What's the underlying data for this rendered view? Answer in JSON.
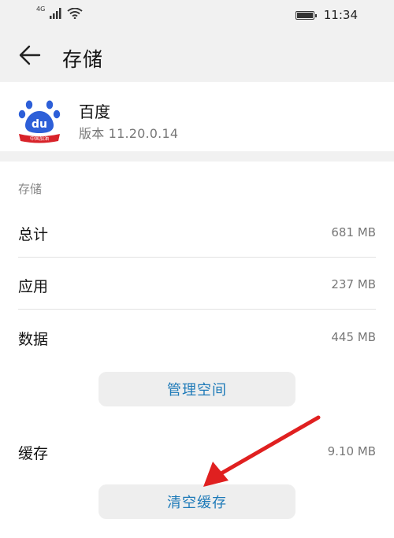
{
  "status_bar": {
    "network": "4G",
    "time": "11:34"
  },
  "header": {
    "title": "存储"
  },
  "app": {
    "name": "百度",
    "version": "版本 11.20.0.14",
    "logo_text": "du",
    "logo_banner": "中国加油"
  },
  "storage": {
    "section_label": "存储",
    "rows": [
      {
        "label": "总计",
        "value": "681 MB"
      },
      {
        "label": "应用",
        "value": "237 MB"
      },
      {
        "label": "数据",
        "value": "445 MB"
      }
    ],
    "manage_button": "管理空间",
    "cache": {
      "label": "缓存",
      "value": "9.10 MB"
    },
    "clear_cache_button": "清空缓存"
  },
  "colors": {
    "accent": "#1e7ab8",
    "arrow": "#e02020",
    "logo_blue": "#2d5fd8",
    "logo_red": "#d8232a"
  }
}
